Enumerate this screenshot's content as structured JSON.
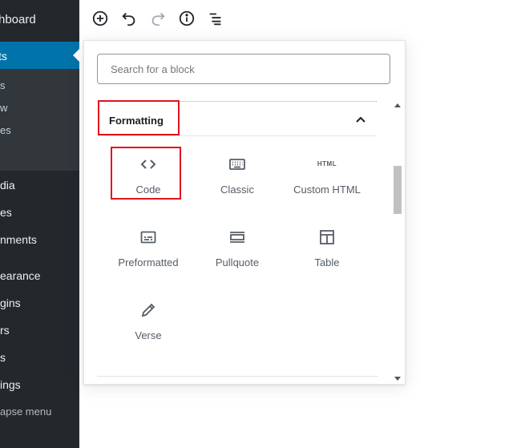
{
  "sidebar": {
    "items": [
      {
        "label": "hboard"
      },
      {
        "label": "ts"
      },
      {
        "label": "dia"
      },
      {
        "label": "es"
      },
      {
        "label": "nments"
      },
      {
        "label": "earance"
      },
      {
        "label": "gins"
      },
      {
        "label": "rs"
      },
      {
        "label": "s"
      },
      {
        "label": "ings"
      }
    ],
    "subitems": [
      {
        "label": "s"
      },
      {
        "label": "w"
      },
      {
        "label": "es"
      }
    ],
    "collapse_label": "apse menu"
  },
  "toolbar": {
    "icons": [
      "add-block-icon",
      "undo-icon",
      "redo-icon",
      "info-icon",
      "outline-icon"
    ]
  },
  "inserter": {
    "search_placeholder": "Search for a block",
    "panel_title": "Formatting",
    "blocks": [
      {
        "label": "Code",
        "icon": "code-icon"
      },
      {
        "label": "Classic",
        "icon": "keyboard-icon"
      },
      {
        "label": "Custom HTML",
        "icon": "html-icon",
        "icon_text": "HTML"
      },
      {
        "label": "Preformatted",
        "icon": "preformatted-icon"
      },
      {
        "label": "Pullquote",
        "icon": "pullquote-icon"
      },
      {
        "label": "Table",
        "icon": "table-icon"
      },
      {
        "label": "Verse",
        "icon": "verse-icon"
      }
    ]
  },
  "colors": {
    "sidebar_bg": "#23282d",
    "active_bg": "#0073aa",
    "highlight": "#e0141c"
  }
}
